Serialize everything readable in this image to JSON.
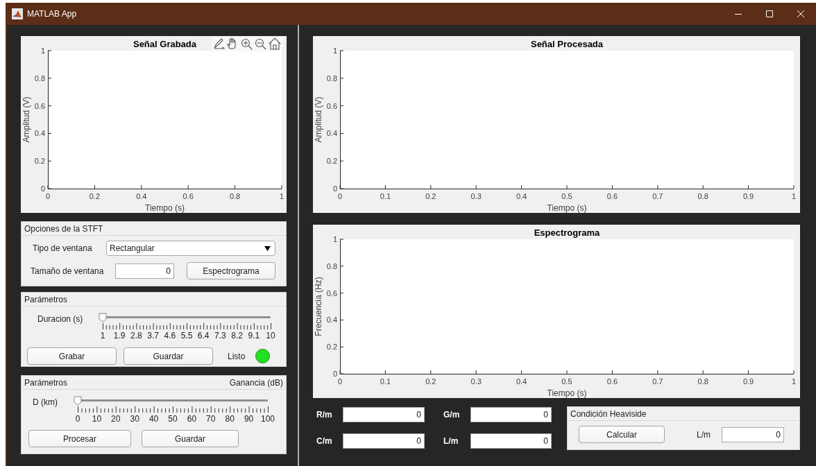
{
  "window": {
    "title": "MATLAB App"
  },
  "recorded_plot": {
    "toolbar": true,
    "chart_data": {
      "type": "line",
      "title": "Señal Grabada",
      "xlabel": "Tiempo (s)",
      "ylabel": "Amplitud (V)",
      "xlim": [
        0,
        1
      ],
      "ylim": [
        0,
        1
      ],
      "xticks": [
        0,
        0.2,
        0.4,
        0.6,
        0.8,
        1
      ],
      "yticks": [
        0,
        0.2,
        0.4,
        0.6,
        0.8,
        1
      ]
    }
  },
  "stft_options": {
    "title": "Opciones de la STFT",
    "window_type": {
      "label": "Tipo de ventana",
      "value": "Rectangular"
    },
    "window_size": {
      "label": "Tamaño de ventana",
      "value": "0"
    },
    "button": "Espectrograma"
  },
  "recording": {
    "title": "Parámetros",
    "duration": {
      "label": "Duracion (s)",
      "level": 0,
      "ticks": [
        "1",
        "1.9",
        "2.8",
        "3.7",
        "4.6",
        "5.5",
        "6.4",
        "7.3",
        "8.2",
        "9.1",
        "10"
      ]
    },
    "buttons": [
      "Grabar",
      "Guardar"
    ],
    "status": {
      "label": "Listo",
      "color": "#22e022"
    }
  },
  "processing": {
    "title": "Parámetros",
    "gain_label": "Ganancia (dB)",
    "distance": {
      "label": "D (km)",
      "level": 0,
      "ticks": [
        "0",
        "10",
        "20",
        "30",
        "40",
        "50",
        "60",
        "70",
        "80",
        "90",
        "100"
      ]
    },
    "buttons": [
      "Procesar",
      "Guardar"
    ]
  },
  "processed_plot": {
    "chart_data": {
      "type": "line",
      "title": "Señal Procesada",
      "xlabel": "Tiempo (s)",
      "ylabel": "Amplitud (V)",
      "xlim": [
        0,
        1
      ],
      "ylim": [
        0,
        1
      ],
      "xticks": [
        0,
        0.1,
        0.2,
        0.3,
        0.4,
        0.5,
        0.6,
        0.7,
        0.8,
        0.9,
        1
      ],
      "yticks": [
        0,
        0.2,
        0.4,
        0.6,
        0.8,
        1
      ]
    }
  },
  "spectrogram": {
    "chart_data": {
      "type": "line",
      "title": "Espectrograma",
      "xlabel": "Tiempo (s)",
      "ylabel": "Frecuencia (Hz)",
      "xlim": [
        0,
        1
      ],
      "ylim": [
        0,
        1
      ],
      "xticks": [
        0,
        0.1,
        0.2,
        0.3,
        0.4,
        0.5,
        0.6,
        0.7,
        0.8,
        0.9,
        1
      ],
      "yticks": [
        0,
        0.2,
        0.4,
        0.6,
        0.8,
        1
      ]
    }
  },
  "line_parameters": [
    {
      "label": "R/m",
      "value": "0"
    },
    {
      "label": "G/m",
      "value": "0"
    },
    {
      "label": "C/m",
      "value": "0"
    },
    {
      "label": "L/m",
      "value": "0"
    }
  ],
  "heaviside": {
    "title": "Condición Heaviside",
    "button": "Calcular",
    "field": {
      "label": "L/m",
      "value": "0"
    }
  }
}
